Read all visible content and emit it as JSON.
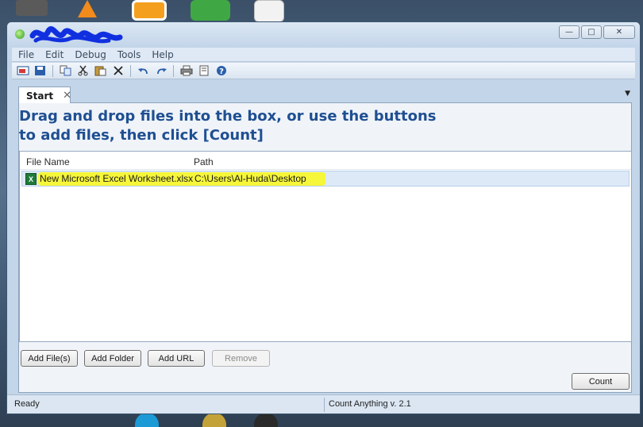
{
  "menu": [
    "File",
    "Edit",
    "Debug",
    "Tools",
    "Help"
  ],
  "toolbar": {
    "icons": [
      "new-count-icon",
      "save-icon",
      "copy-icon",
      "cut-icon",
      "paste-icon",
      "delete-icon",
      "undo-icon",
      "redo-icon",
      "print-icon",
      "print-preview-icon",
      "help-icon"
    ]
  },
  "tabs": [
    {
      "label": "Start"
    }
  ],
  "instructions": {
    "line1": "Drag and drop files into the box, or use the buttons",
    "line2": "to add files, then click [Count]"
  },
  "file_list": {
    "columns": [
      "File Name",
      "Path"
    ],
    "rows": [
      {
        "file_name": "New Microsoft Excel Worksheet.xlsx",
        "path": "C:\\Users\\Al-Huda\\Desktop"
      }
    ]
  },
  "buttons": {
    "add_files": "Add File(s)",
    "add_folder": "Add Folder",
    "add_url": "Add URL",
    "remove": "Remove",
    "count": "Count"
  },
  "status": {
    "left": "Ready",
    "right": "Count Anything v. 2.1"
  },
  "colors": {
    "heading": "#1f4f92",
    "highlight": "#f6f63a",
    "scribble": "#1030e0"
  }
}
